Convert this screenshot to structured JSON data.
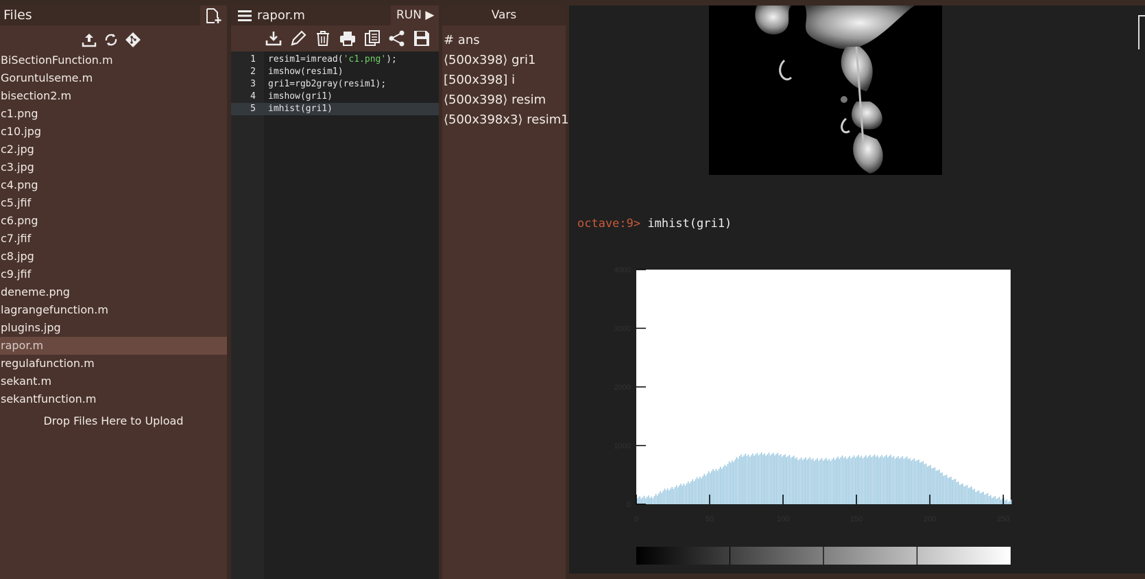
{
  "files": {
    "title": "Files",
    "items": [
      "BiSectionFunction.m",
      "Goruntulseme.m",
      "bisection2.m",
      "c1.png",
      "c10.jpg",
      "c2.jpg",
      "c3.jpg",
      "c4.png",
      "c5.jfif",
      "c6.png",
      "c7.jfif",
      "c8.jpg",
      "c9.jfif",
      "deneme.png",
      "lagrangefunction.m",
      "plugins.jpg",
      "rapor.m",
      "regulafunction.m",
      "sekant.m",
      "sekantfunction.m"
    ],
    "selected_index": 16,
    "drop_label": "Drop Files Here to Upload"
  },
  "editor": {
    "filename": "rapor.m",
    "run_label": "RUN ▶",
    "lines": [
      {
        "n": "1",
        "pre": "resim1=imread(",
        "str": "'c1.png'",
        "post": ");"
      },
      {
        "n": "2",
        "pre": "imshow(resim1)",
        "str": "",
        "post": ""
      },
      {
        "n": "3",
        "pre": "gri1=rgb2gray(resim1);",
        "str": "",
        "post": ""
      },
      {
        "n": "4",
        "pre": "imshow(gri1)",
        "str": "",
        "post": ""
      },
      {
        "n": "5",
        "pre": "imhist(gri1)",
        "str": "",
        "post": ""
      }
    ],
    "active_line": 5
  },
  "vars": {
    "title": "Vars",
    "items": [
      "# ans",
      "⟨500x398⟩ gri1",
      "[500x398] i",
      "⟨500x398⟩ resim",
      "⟨500x398x3⟩ resim1"
    ]
  },
  "console": {
    "prompt": "octave:9>",
    "command": "imhist(gri1)"
  },
  "chart_data": {
    "type": "bar",
    "title": "",
    "xlabel": "",
    "ylabel": "",
    "xlim": [
      0,
      255
    ],
    "ylim": [
      0,
      4000
    ],
    "xticks": [
      "0",
      "50",
      "100",
      "150",
      "200",
      "250"
    ],
    "yticks": [
      "0",
      "1000",
      "2000",
      "3000",
      "4000"
    ],
    "bar_color": "#9ecae1",
    "series": [
      {
        "x_points": [
          0,
          10,
          20,
          30,
          40,
          50,
          60,
          70,
          80,
          90,
          100,
          110,
          120,
          130,
          140,
          150,
          160,
          170,
          180,
          190,
          200,
          210,
          220,
          230,
          240,
          250,
          255
        ],
        "values": [
          120,
          120,
          250,
          320,
          420,
          550,
          650,
          820,
          850,
          860,
          840,
          780,
          770,
          760,
          800,
          810,
          820,
          820,
          800,
          760,
          650,
          500,
          360,
          250,
          150,
          80,
          60
        ]
      }
    ],
    "colorbar": true
  },
  "colors": {
    "accent": "#c85a3a",
    "panel": "#4a332c",
    "header": "#3c2a24"
  }
}
